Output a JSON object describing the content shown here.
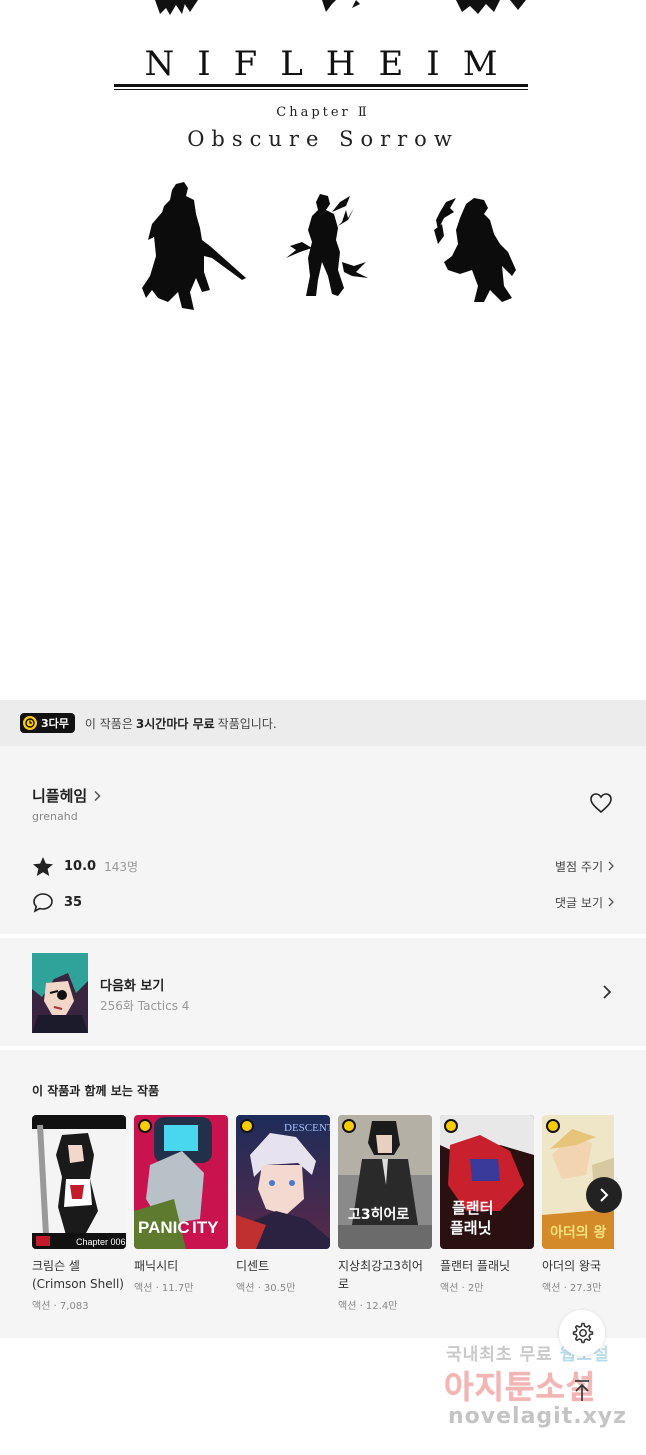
{
  "art": {
    "title": "NIFLHEIM",
    "chapter": "Chapter Ⅱ",
    "subtitle": "Obscure Sorrow"
  },
  "notice": {
    "badge": "3다무",
    "text_before": "이 작품은",
    "text_bold": "3시간마다 무료",
    "text_after": "작품입니다."
  },
  "series": {
    "title": "니플헤임",
    "author": "grenahd",
    "rating": "10.0",
    "rating_count": "143명",
    "rate_link": "별점 주기",
    "comment_count": "35",
    "comment_link": "댓글 보기"
  },
  "next_episode": {
    "label": "다음화 보기",
    "subtitle": "256화 Tactics 4"
  },
  "recommendations": {
    "heading": "이 작품과 함께 보는 작품",
    "items": [
      {
        "title": "크림슨 셀(Crimson Shell)",
        "meta": "액션 · 7,083",
        "cover_color": "#1a1a1a",
        "cover_label": "Chapter 006"
      },
      {
        "title": "패닉시티",
        "meta": "액션 · 11.7만",
        "cover_color": "#c8134e",
        "cover_label": "PANIC CITY"
      },
      {
        "title": "디센트",
        "meta": "액션 · 30.5만",
        "cover_color": "#2b4a86",
        "cover_label": "DESCENT"
      },
      {
        "title": "지상최강고3히어로",
        "meta": "액션 · 12.4만",
        "cover_color": "#4a4a4a",
        "cover_label": "지상최강 고3히어로"
      },
      {
        "title": "플랜터 플래닛",
        "meta": "액션 · 2만",
        "cover_color": "#b5202a",
        "cover_label": "플랜터 플래닛"
      },
      {
        "title": "아더의 왕국",
        "meta": "액션 · 27.3만",
        "cover_color": "#e9dcb0",
        "cover_label": "아더의 왕국"
      }
    ]
  },
  "watermark": {
    "line1_a": "국내최초 무료",
    "line1_b": "웹소설",
    "line2": "아지툰소설",
    "line3": "novelagit.xyz"
  },
  "colors": {
    "accent_yellow": "#ffcc00",
    "panel_bg": "#f5f5f5",
    "notice_bg": "#ececec"
  }
}
